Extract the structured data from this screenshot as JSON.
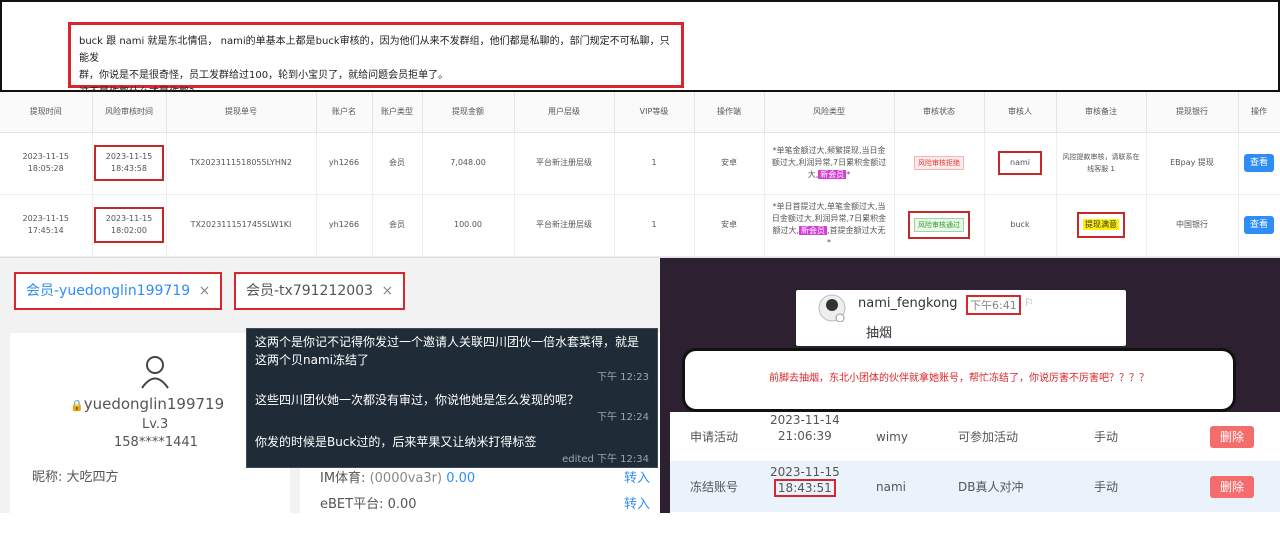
{
  "note": {
    "line1": "buck 跟 nami 就是东北情侣， nami的单基本上都是buck审核的，因为他们从来不发群组，他们都是私聊的，部门规定不可私聊，只能发",
    "line2": "群，你说是不是很奇怪，员工发群给过100，轮到小宝贝了，就给问题会员拒单了。",
    "line3": "这不是作弊什么才是作弊?"
  },
  "table": {
    "headers": [
      "提现时间",
      "风险审核时间",
      "提现单号",
      "账户名",
      "账户类型",
      "提现金额",
      "用户层级",
      "VIP等级",
      "操作端",
      "风险类型",
      "审核状态",
      "审核人",
      "审核备注",
      "提现银行",
      "操作"
    ],
    "rows": [
      {
        "time1": "2023-11-15",
        "time2": "18:05:28",
        "rtime1": "2023-11-15",
        "rtime2": "18:43:58",
        "order": "TX2023111518055LYHN2",
        "account": "yh1266",
        "type": "会员",
        "amount": "7,048.00",
        "level": "平台新注册层级",
        "vip": "1",
        "client": "安卓",
        "risk_pre": "*单笔金额过大,频繁提现,当日金额过大,利润异常,7日累积金额过大,",
        "risk_tag": "新会员",
        "risk_post": "*",
        "status": "风险审核拒绝",
        "auditor": "nami",
        "remark": "风控提款审核，请联系在线客服 1",
        "bank": "EBpay 提现",
        "action": "查看"
      },
      {
        "time1": "2023-11-15",
        "time2": "17:45:14",
        "rtime1": "2023-11-15",
        "rtime2": "18:02:00",
        "order": "TX202311151745SLW1KI",
        "account": "yh1266",
        "type": "会员",
        "amount": "100.00",
        "level": "平台新注册层级",
        "vip": "1",
        "client": "安卓",
        "risk_pre": "*单日首提过大,单笔金额过大,当日金额过大,利润异常,7日累积金额过大,",
        "risk_tag": "新会员",
        "risk_post": ",首提金额过大无*",
        "status": "风险审核通过",
        "auditor": "buck",
        "remark": "提现满意",
        "bank": "中国银行",
        "action": "查看"
      }
    ]
  },
  "member": {
    "tab1": "会员-yuedonglin199719",
    "tab2": "会员-tx791212003",
    "close": "×",
    "username": "yuedonglin199719",
    "level": "Lv.3",
    "phone": "158****1441",
    "nickname_label": "昵称:",
    "nickname": "大吃四方",
    "im_label": "IM体育:",
    "im_acct": "(0000va3r)",
    "im_value": "0.00",
    "ebet_label": "eBET平台:",
    "ebet_value": "0.00",
    "transfer": "转入"
  },
  "chat": {
    "messages": [
      {
        "text": "这两个是你记不记得你发过一个邀请人关联四川团伙一倍水套菜得，就是这两个贝nami冻结了",
        "time": "下午 12:23"
      },
      {
        "text": "这些四川团伙她一次都没有审过，你说他她是怎么发现的呢？",
        "time": "下午 12:24"
      },
      {
        "text": "你发的时候是Buck过的，后来苹果又让纳米打得标签",
        "time": "edited 下午 12:34"
      }
    ]
  },
  "telegram": {
    "name": "nami_fengkong",
    "time": "下午6:41",
    "message": "抽烟"
  },
  "warning": "前脚去抽烟，东北小团体的伙伴就拿她账号，帮忙冻结了，你说厉害不厉害吧？？？？",
  "actions": [
    {
      "type": "申请活动",
      "date": "2023-11-14",
      "time": "21:06:39",
      "user": "wimy",
      "detail": "可参加活动",
      "mode": "手动",
      "btn": "删除"
    },
    {
      "type": "冻结账号",
      "date": "2023-11-15",
      "time": "18:43:51",
      "user": "nami",
      "detail": "DB真人对冲",
      "mode": "手动",
      "btn": "删除"
    }
  ],
  "colors": {
    "red_border": "#d9262c",
    "blue_btn": "#2f8ef5",
    "del_btn": "#f56c6c"
  }
}
